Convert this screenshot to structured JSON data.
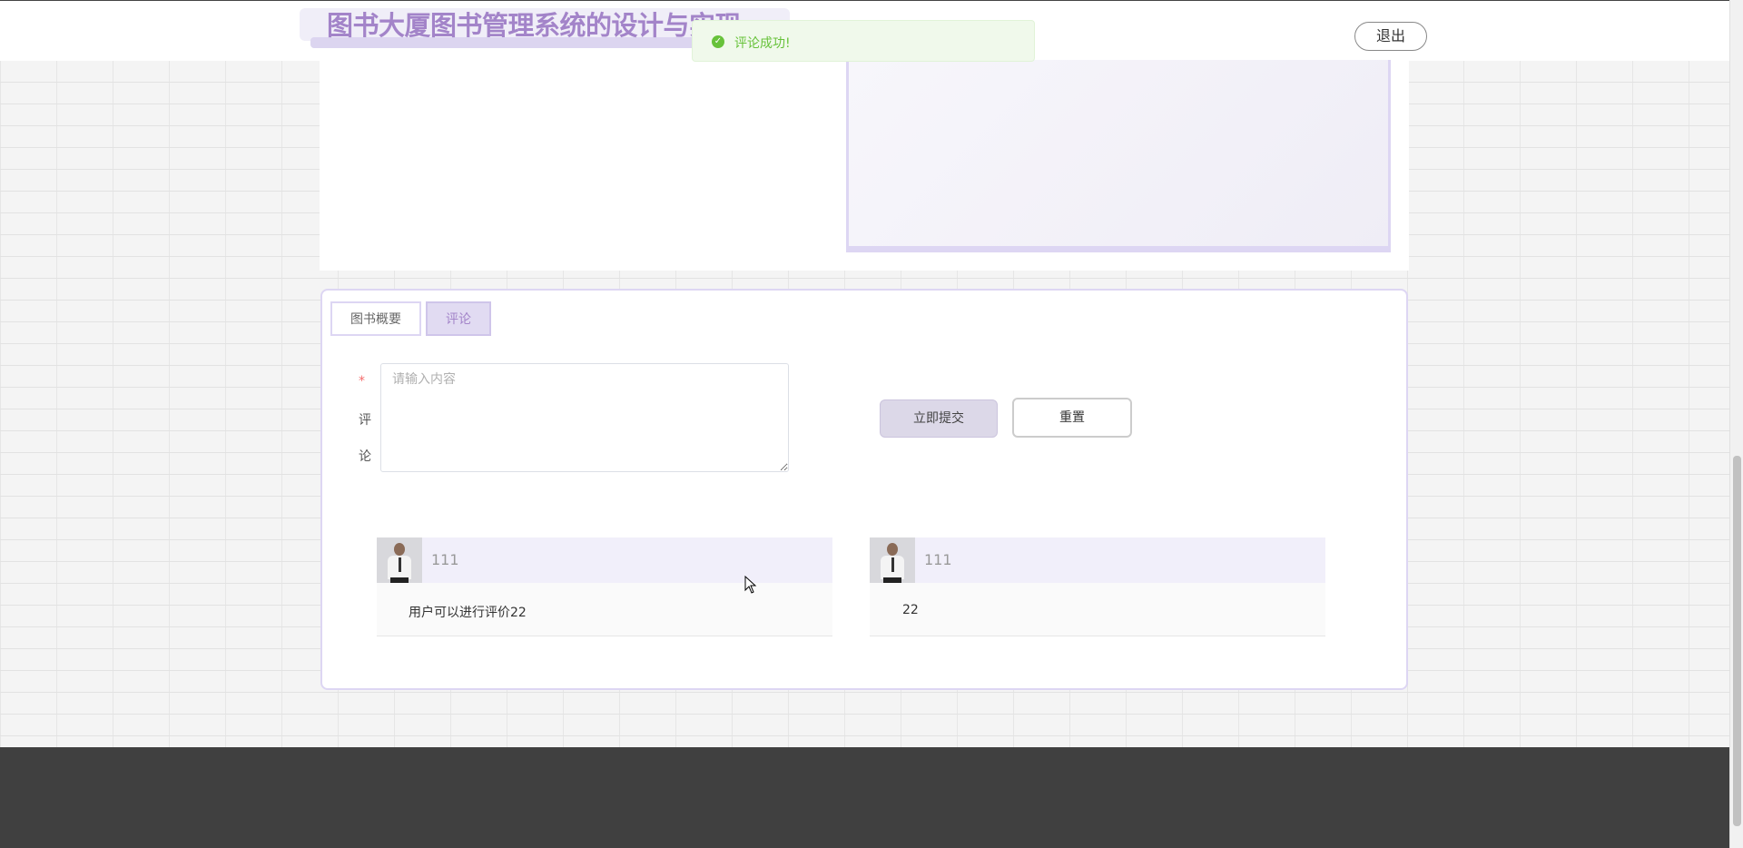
{
  "header": {
    "title": "图书大厦图书管理系统的设计与实现",
    "logout_label": "退出"
  },
  "toast": {
    "message": "评论成功!",
    "icon": "check-circle-icon"
  },
  "tabs": [
    {
      "label": "图书概要",
      "active": false
    },
    {
      "label": "评论",
      "active": true
    }
  ],
  "comment_form": {
    "required_mark": "*",
    "label_line1": "评",
    "label_line2": "论",
    "placeholder": "请输入内容",
    "value": "",
    "submit_label": "立即提交",
    "reset_label": "重置"
  },
  "comments": [
    {
      "user": "111",
      "text": "用户可以进行评价22"
    },
    {
      "user": "111",
      "text": "22"
    }
  ],
  "colors": {
    "accent": "#a384c9",
    "success": "#67c23a",
    "footer": "#404040"
  }
}
